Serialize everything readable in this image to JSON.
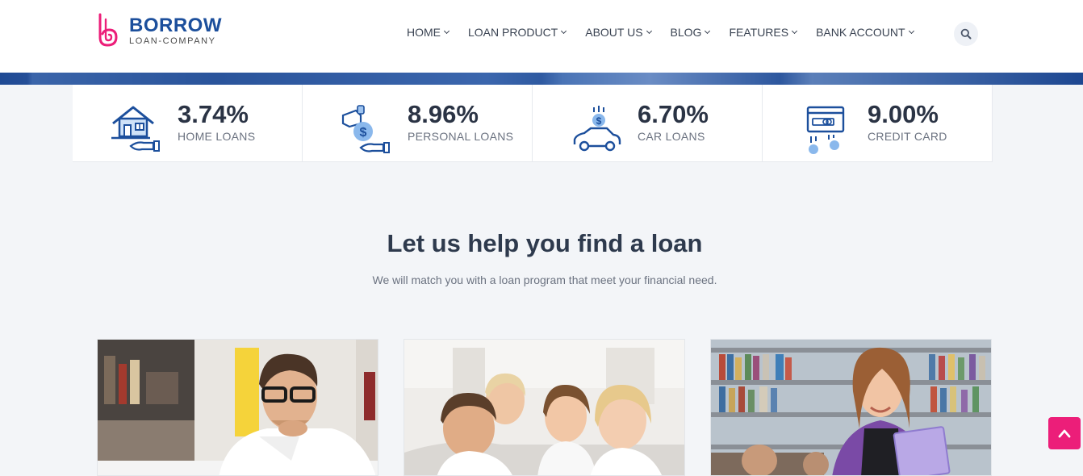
{
  "brand": {
    "name": "BORROW",
    "tagline": "LOAN-COMPANY",
    "primary_color": "#1c4f9c",
    "accent_color": "#ec1e79"
  },
  "nav": {
    "items": [
      {
        "label": "HOME"
      },
      {
        "label": "LOAN PRODUCT"
      },
      {
        "label": "ABOUT US"
      },
      {
        "label": "BLOG"
      },
      {
        "label": "FEATURES"
      },
      {
        "label": "BANK ACCOUNT"
      }
    ],
    "search_icon": "search-icon"
  },
  "stats": [
    {
      "value": "3.74%",
      "label": "HOME LOANS",
      "icon": "house-hand-icon"
    },
    {
      "value": "8.96%",
      "label": "PERSONAL LOANS",
      "icon": "money-hand-icon"
    },
    {
      "value": "6.70%",
      "label": "CAR LOANS",
      "icon": "car-coin-icon"
    },
    {
      "value": "9.00%",
      "label": "CREDIT CARD",
      "icon": "credit-card-icon"
    }
  ],
  "section": {
    "title": "Let us help you find a loan",
    "subtitle": "We will match you with a loan program that meet your financial need."
  },
  "cards": [
    {
      "image": "man-with-glasses-at-desk"
    },
    {
      "image": "family-lying-on-floor"
    },
    {
      "image": "student-in-library"
    }
  ],
  "back_to_top_icon": "chevron-up-icon"
}
